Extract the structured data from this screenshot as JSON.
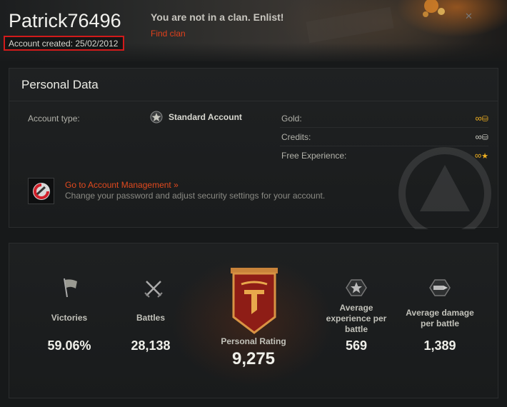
{
  "header": {
    "username": "Patrick76496",
    "account_created": "Account created: 25/02/2012",
    "clan_status": "You are not in a clan. Enlist!",
    "find_clan": "Find clan"
  },
  "personal": {
    "title": "Personal Data",
    "account_type_label": "Account type:",
    "account_type_value": "Standard Account",
    "currencies": [
      {
        "label": "Gold:",
        "icon": "gold-icon",
        "value": "∞"
      },
      {
        "label": "Credits:",
        "icon": "credits-icon",
        "value": "∞"
      },
      {
        "label": "Free Experience:",
        "icon": "free-xp-icon",
        "value": "∞"
      }
    ],
    "management_link": "Go to Account Management »",
    "management_desc": "Change your password and adjust security settings for your account."
  },
  "stats": {
    "victories": {
      "label": "Victories",
      "value": "59.06%"
    },
    "battles": {
      "label": "Battles",
      "value": "28,138"
    },
    "rating": {
      "label": "Personal Rating",
      "value": "9,275"
    },
    "avg_xp": {
      "label": "Average experience per battle",
      "value": "569"
    },
    "avg_damage": {
      "label": "Average damage per battle",
      "value": "1,389"
    }
  },
  "colors": {
    "accent": "#e0401c",
    "highlight_border": "#d21a1a",
    "gold": "#f0b020"
  }
}
